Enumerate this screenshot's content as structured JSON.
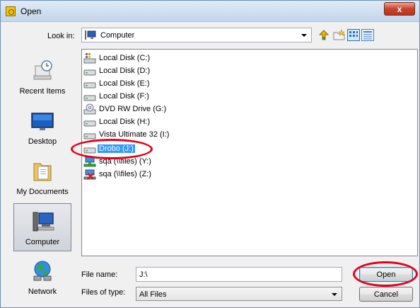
{
  "window": {
    "title": "Open",
    "close_glyph": "x"
  },
  "lookin": {
    "label": "Look in:",
    "value": "Computer",
    "icon": "computer-icon"
  },
  "toolbar": {
    "icons": [
      "up-folder-icon",
      "new-folder-icon",
      "view-menu-icon",
      "details-view-icon"
    ]
  },
  "places": [
    {
      "label": "Recent Items",
      "icon": "recent-items-icon"
    },
    {
      "label": "Desktop",
      "icon": "desktop-icon"
    },
    {
      "label": "My Documents",
      "icon": "my-documents-icon"
    },
    {
      "label": "Computer",
      "icon": "computer-icon",
      "selected": true
    },
    {
      "label": "Network",
      "icon": "network-icon"
    }
  ],
  "files": [
    {
      "label": "Local Disk (C:)",
      "icon": "system-drive-icon"
    },
    {
      "label": "Local Disk (D:)",
      "icon": "hard-drive-icon"
    },
    {
      "label": "Local Disk (E:)",
      "icon": "hard-drive-icon"
    },
    {
      "label": "Local Disk (F:)",
      "icon": "hard-drive-icon"
    },
    {
      "label": "DVD RW Drive (G:)",
      "icon": "dvd-drive-icon"
    },
    {
      "label": "Local Disk (H:)",
      "icon": "hard-drive-icon"
    },
    {
      "label": "Vista Ultimate 32 (I:)",
      "icon": "hard-drive-icon"
    },
    {
      "label": "Drobo (J:)",
      "icon": "hard-drive-icon",
      "selected": true
    },
    {
      "label": "sqa (\\\\files) (Y:)",
      "icon": "network-drive-icon"
    },
    {
      "label": "sqa (\\\\files) (Z:)",
      "icon": "disconnected-network-drive-icon"
    }
  ],
  "filename": {
    "label": "File name:",
    "value": "J:\\"
  },
  "filetype": {
    "label": "Files of type:",
    "value": "All Files"
  },
  "buttons": {
    "open": "Open",
    "cancel": "Cancel"
  },
  "colors": {
    "selection": "#3399ff",
    "annotation": "#e4001b",
    "close_button": "#c7432b"
  }
}
